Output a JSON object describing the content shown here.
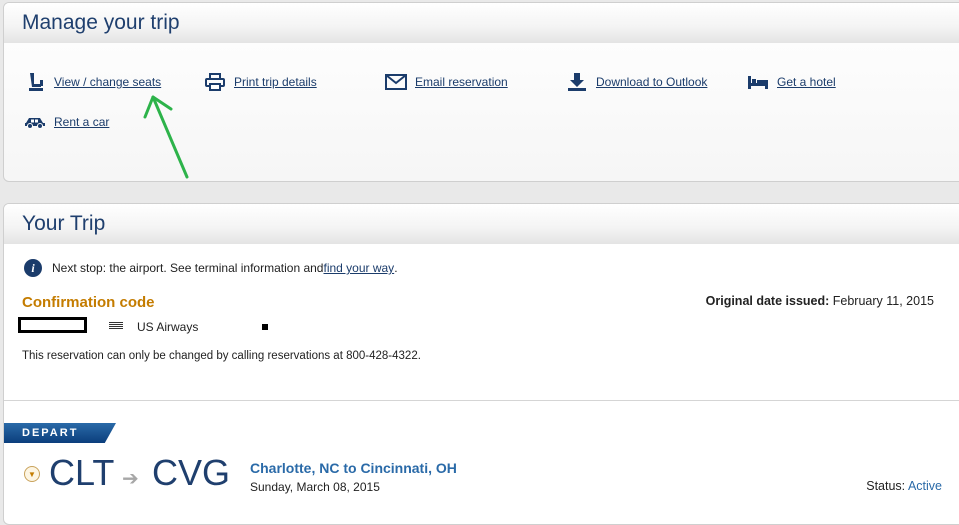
{
  "manage": {
    "title": "Manage your trip",
    "actions": [
      {
        "label": "View / change seats",
        "icon": "seat-icon"
      },
      {
        "label": "Print trip details",
        "icon": "printer-icon"
      },
      {
        "label": "Email reservation",
        "icon": "envelope-icon"
      },
      {
        "label": "Download to Outlook",
        "icon": "download-icon"
      },
      {
        "label": "Get a hotel",
        "icon": "bed-icon"
      },
      {
        "label": "Rent a car",
        "icon": "car-icon"
      }
    ]
  },
  "trip": {
    "title": "Your Trip",
    "info_text": "Next stop: the airport. See terminal information and ",
    "info_link": "find your way",
    "info_end": ".",
    "confirmation_title": "Confirmation code",
    "airline": "US Airways",
    "note": "This reservation can only be changed by calling reservations at 800-428-4322.",
    "issued_label": "Original date issued:",
    "issued_value": "February 11, 2015"
  },
  "depart": {
    "tag": "DEPART",
    "from": "CLT",
    "to": "CVG",
    "route": "Charlotte, NC to Cincinnati, OH",
    "date": "Sunday, March 08, 2015",
    "status_label": "Status:",
    "status_value": "Active"
  },
  "colors": {
    "link": "#1b3c6b",
    "title": "#1f3f6e",
    "accent_orange": "#c47c00",
    "annotation_arrow": "#2db34a"
  }
}
